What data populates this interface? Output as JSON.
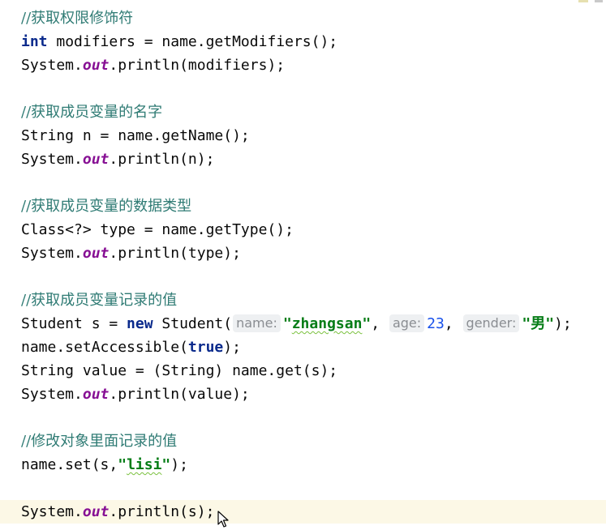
{
  "code": {
    "l1_comment": "//获取权限修饰符",
    "l2_kw": "int",
    "l2_rest": " modifiers = name.getModifiers();",
    "l3_pre": "System.",
    "l3_field": "out",
    "l3_post": ".println(modifiers);",
    "l5_comment": "//获取成员变量的名字",
    "l6": "String n = name.getName();",
    "l7_pre": "System.",
    "l7_field": "out",
    "l7_post": ".println(n);",
    "l9_comment": "//获取成员变量的数据类型",
    "l10": "Class<?> type = name.getType();",
    "l11_pre": "System.",
    "l11_field": "out",
    "l11_post": ".println(type);",
    "l13_comment": "//获取成员变量记录的值",
    "l14_a": "Student s = ",
    "l14_kw": "new",
    "l14_b": " Student(",
    "l14_hint1": "name:",
    "l14_str1_q1": "\"",
    "l14_str1": "zhangsan",
    "l14_str1_q2": "\"",
    "l14_sep1": ", ",
    "l14_hint2": "age:",
    "l14_num": "23",
    "l14_sep2": ", ",
    "l14_hint3": "gender:",
    "l14_str2": "\"男\"",
    "l14_end": ");",
    "l15_a": "name.setAccessible(",
    "l15_kw": "true",
    "l15_b": ");",
    "l16": "String value = (String) name.get(s);",
    "l17_pre": "System.",
    "l17_field": "out",
    "l17_post": ".println(value);",
    "l19_comment": "//修改对象里面记录的值",
    "l20_a": "name.set(s,",
    "l20_q1": "\"",
    "l20_str": "lisi",
    "l20_q2": "\"",
    "l20_b": ");",
    "l22_pre": "System.",
    "l22_field": "out",
    "l22_post": ".println(s);"
  },
  "colors": {
    "comment": "#2f7b74",
    "keyword": "#0a2a8c",
    "static_field": "#871094",
    "string": "#067d17",
    "number": "#1750eb",
    "current_line": "#fcf8e6"
  }
}
